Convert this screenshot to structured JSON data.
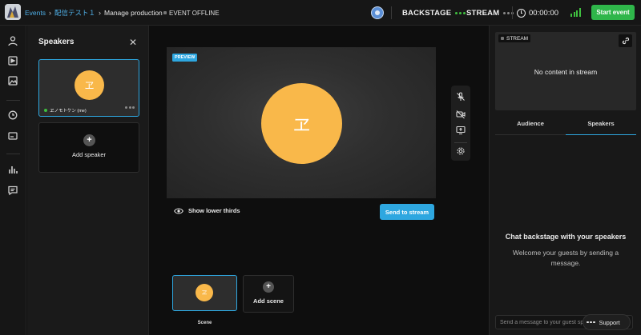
{
  "topbar": {
    "breadcrumb": [
      {
        "label": "Events"
      },
      {
        "label": "配信テスト１"
      },
      {
        "label": "Manage production"
      }
    ],
    "event_status": "EVENT OFFLINE",
    "backstage_label": "BACKSTAGE",
    "backstage_dot_color": "#3fbf3f",
    "stream_label": "STREAM",
    "stream_dot_color": "#8a8a8a",
    "timer": "00:00:00",
    "start_event_label": "Start event",
    "accent_green": "#2fb64a",
    "icons": [
      "logo-icon",
      "chevron-right-icon",
      "user-avatar-icon",
      "clock-icon",
      "signal-strength-icon"
    ]
  },
  "rail": {
    "icons": [
      "user-icon",
      "media-icon",
      "image-icon",
      "clock-loop-icon",
      "caption-icon",
      "analytics-icon",
      "chat-icon"
    ]
  },
  "speakers": {
    "title": "Speakers",
    "cards": [
      {
        "avatar_initial": "ヱ",
        "name": "ヱノモトケン (me)",
        "status_color": "#3fbf3f"
      }
    ],
    "add_label": "Add speaker"
  },
  "stage": {
    "preview_badge": "PREVIEW",
    "preview_avatar_initial": "ヱ",
    "avatar_color": "#f9b84a",
    "controls": [
      "mic-off-icon",
      "camera-off-icon",
      "screen-share-icon",
      "settings-icon"
    ],
    "lower_thirds_label": "Show lower thirds",
    "send_to_stream_label": "Send to stream",
    "accent_blue": "#2ea7e0"
  },
  "scenes": {
    "items": [
      {
        "label": "Scene",
        "avatar_initial": "ヱ"
      }
    ],
    "add_label": "Add scene"
  },
  "right_panel": {
    "stream_badge": "STREAM",
    "no_content": "No content in stream",
    "tabs": [
      {
        "label": "Audience",
        "active": false
      },
      {
        "label": "Speakers",
        "active": true
      }
    ],
    "chat_title": "Chat backstage with your speakers",
    "chat_subtitle": "Welcome your guests by sending a message.",
    "chat_placeholder": "Send a message to your guest speakers",
    "support_label": "Support"
  }
}
